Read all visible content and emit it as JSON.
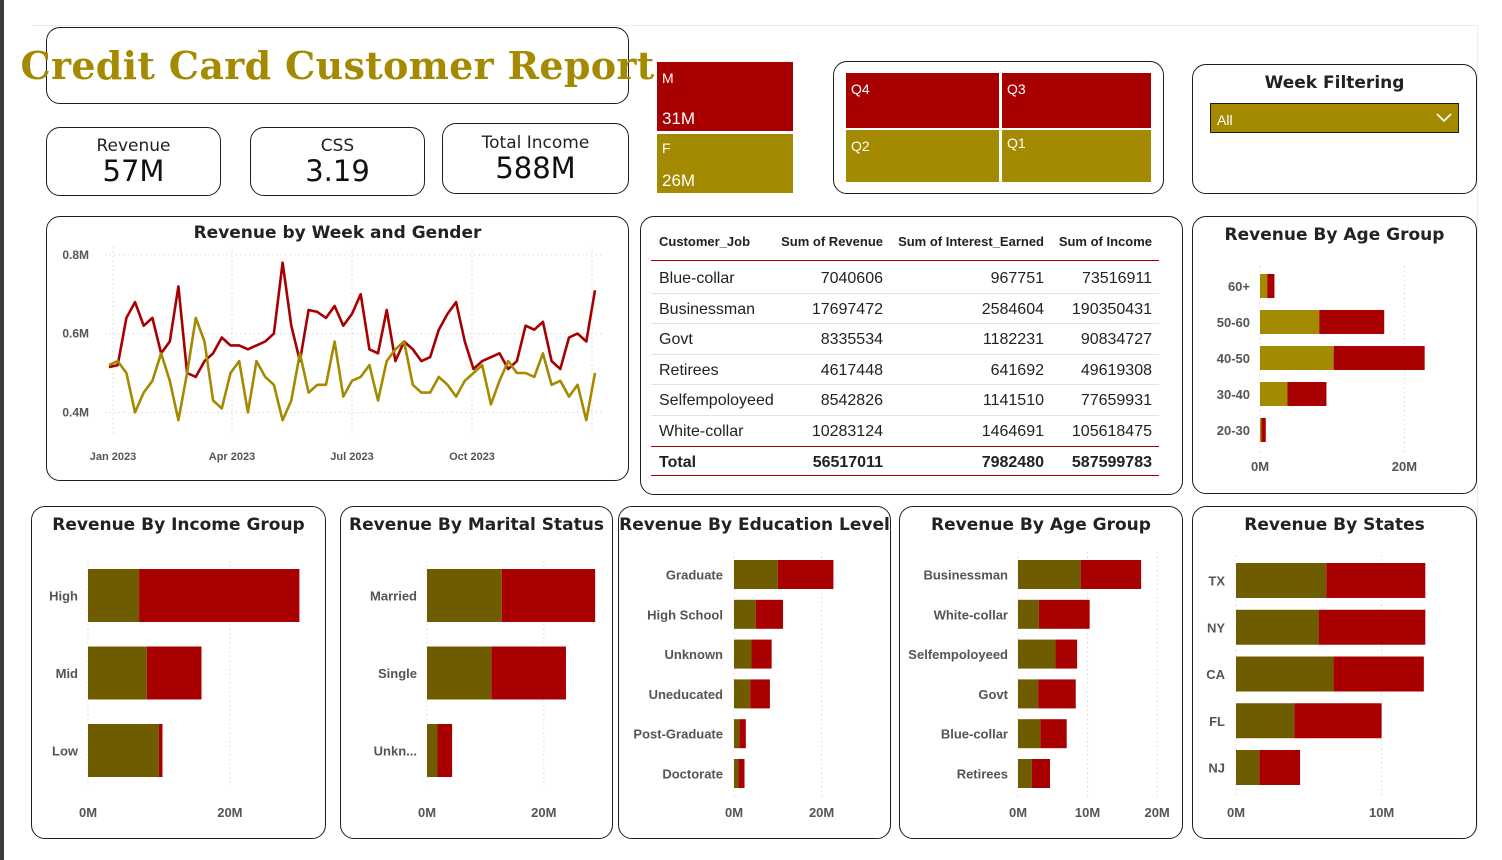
{
  "report": {
    "title": "Credit Card Customer Report"
  },
  "kpis": {
    "revenue": {
      "label": "Revenue",
      "value": "57M"
    },
    "css": {
      "label": "CSS",
      "value": "3.19"
    },
    "income": {
      "label": "Total Income",
      "value": "588M"
    }
  },
  "gender_tree": {
    "cells": [
      {
        "label": "M",
        "value": "31M"
      },
      {
        "label": "F",
        "value": "26M"
      }
    ]
  },
  "quarter_tree": {
    "cells": [
      "Q4",
      "Q3",
      "Q2",
      "Q1"
    ]
  },
  "filter": {
    "title": "Week Filtering",
    "selected": "All"
  },
  "colors": {
    "male": "#a80000",
    "female": "#a48a00",
    "female_dark": "#6f5c00",
    "grid": "#d9d9d9"
  },
  "table": {
    "headers": [
      "Customer_Job",
      "Sum of Revenue",
      "Sum of Interest_Earned",
      "Sum of Income"
    ],
    "rows": [
      [
        "Blue-collar",
        "7040606",
        "967751",
        "73516911"
      ],
      [
        "Businessman",
        "17697472",
        "2584604",
        "190350431"
      ],
      [
        "Govt",
        "8335534",
        "1182231",
        "90834727"
      ],
      [
        "Retirees",
        "4617448",
        "641692",
        "49619308"
      ],
      [
        "Selfempoloyeed",
        "8542826",
        "1141510",
        "77659931"
      ],
      [
        "White-collar",
        "10283124",
        "1464691",
        "105618475"
      ]
    ],
    "total": [
      "Total",
      "56517011",
      "7982480",
      "587599783"
    ]
  },
  "chart_data": [
    {
      "id": "week_gender",
      "type": "line",
      "title": "Revenue by Week and Gender",
      "x_ticks": [
        "Jan 2023",
        "Apr 2023",
        "Jul 2023",
        "Oct 2023"
      ],
      "y_ticks": [
        "0.4M",
        "0.6M",
        "0.8M"
      ],
      "ylim": [
        0.35,
        0.82
      ],
      "series": [
        {
          "color": "#a80000",
          "values": [
            0.515,
            0.52,
            0.64,
            0.68,
            0.62,
            0.64,
            0.55,
            0.58,
            0.72,
            0.5,
            0.49,
            0.53,
            0.55,
            0.59,
            0.57,
            0.57,
            0.56,
            0.57,
            0.58,
            0.6,
            0.78,
            0.62,
            0.53,
            0.66,
            0.655,
            0.64,
            0.67,
            0.62,
            0.65,
            0.7,
            0.56,
            0.55,
            0.66,
            0.53,
            0.58,
            0.56,
            0.53,
            0.54,
            0.61,
            0.65,
            0.68,
            0.58,
            0.51,
            0.53,
            0.54,
            0.55,
            0.51,
            0.53,
            0.62,
            0.61,
            0.63,
            0.53,
            0.51,
            0.59,
            0.6,
            0.58,
            0.71
          ]
        },
        {
          "color": "#a48a00",
          "values": [
            0.52,
            0.53,
            0.5,
            0.4,
            0.45,
            0.48,
            0.55,
            0.48,
            0.38,
            0.5,
            0.64,
            0.58,
            0.43,
            0.41,
            0.5,
            0.53,
            0.4,
            0.53,
            0.49,
            0.47,
            0.38,
            0.43,
            0.55,
            0.45,
            0.47,
            0.47,
            0.58,
            0.44,
            0.48,
            0.49,
            0.52,
            0.43,
            0.53,
            0.56,
            0.58,
            0.47,
            0.45,
            0.45,
            0.49,
            0.47,
            0.44,
            0.48,
            0.5,
            0.52,
            0.42,
            0.48,
            0.53,
            0.5,
            0.5,
            0.49,
            0.55,
            0.47,
            0.48,
            0.44,
            0.47,
            0.38,
            0.5
          ]
        }
      ]
    },
    {
      "id": "age_top",
      "type": "bar",
      "title": "Revenue By Age Group",
      "categories": [
        "60+",
        "50-60",
        "40-50",
        "30-40",
        "20-30"
      ],
      "series": [
        {
          "color": "#a48a00",
          "values": [
            1.0,
            8.2,
            10.2,
            3.8,
            0.2
          ]
        },
        {
          "color": "#a80000",
          "values": [
            1.0,
            9.0,
            12.6,
            5.4,
            0.6
          ]
        }
      ],
      "x_ticks": [
        {
          "v": 0,
          "label": "0M"
        },
        {
          "v": 20,
          "label": "20M"
        }
      ],
      "xlim": [
        0,
        27
      ]
    },
    {
      "id": "income_group",
      "type": "bar",
      "title": "Revenue By Income Group",
      "categories": [
        "High",
        "Mid",
        "Low"
      ],
      "series": [
        {
          "color": "#6f5c00",
          "values": [
            7.2,
            8.3,
            10.0
          ]
        },
        {
          "color": "#a80000",
          "values": [
            22.6,
            7.7,
            0.5
          ]
        }
      ],
      "x_ticks": [
        {
          "v": 0,
          "label": "0M"
        },
        {
          "v": 20,
          "label": "20M"
        }
      ],
      "xlim": [
        0,
        32
      ]
    },
    {
      "id": "marital",
      "type": "bar",
      "title": "Revenue By Marital Status",
      "categories": [
        "Married",
        "Single",
        "Unkn..."
      ],
      "series": [
        {
          "color": "#6f5c00",
          "values": [
            12.8,
            11.0,
            1.8
          ]
        },
        {
          "color": "#a80000",
          "values": [
            16.0,
            12.8,
            2.5
          ]
        }
      ],
      "x_ticks": [
        {
          "v": 0,
          "label": "0M"
        },
        {
          "v": 20,
          "label": "20M"
        }
      ],
      "xlim": [
        0,
        31
      ]
    },
    {
      "id": "education",
      "type": "bar",
      "title": "Revenue By Education Level",
      "categories": [
        "Graduate",
        "High School",
        "Unknown",
        "Uneducated",
        "Post-Graduate",
        "Doctorate"
      ],
      "series": [
        {
          "color": "#6f5c00",
          "values": [
            10.0,
            5.0,
            4.0,
            3.7,
            1.2,
            1.0
          ]
        },
        {
          "color": "#a80000",
          "values": [
            12.7,
            6.2,
            4.6,
            4.5,
            1.5,
            1.4
          ]
        }
      ],
      "x_ticks": [
        {
          "v": 0,
          "label": "0M"
        },
        {
          "v": 20,
          "label": "20M"
        }
      ],
      "xlim": [
        0,
        29
      ]
    },
    {
      "id": "job",
      "type": "bar",
      "title": "Revenue By Age Group",
      "categories": [
        "Businessman",
        "White-collar",
        "Selfempoloyeed",
        "Govt",
        "Blue-collar",
        "Retirees"
      ],
      "series": [
        {
          "color": "#6f5c00",
          "values": [
            9.0,
            3.0,
            5.4,
            2.9,
            3.2,
            2.0
          ]
        },
        {
          "color": "#a80000",
          "values": [
            8.7,
            7.3,
            3.1,
            5.4,
            3.8,
            2.6
          ]
        }
      ],
      "x_ticks": [
        {
          "v": 0,
          "label": "0M"
        },
        {
          "v": 10,
          "label": "10M"
        },
        {
          "v": 20,
          "label": "20M"
        }
      ],
      "xlim": [
        0,
        23
      ]
    },
    {
      "id": "states",
      "type": "bar",
      "title": "Revenue By States",
      "categories": [
        "TX",
        "NY",
        "CA",
        "FL",
        "NJ"
      ],
      "series": [
        {
          "color": "#6f5c00",
          "values": [
            6.2,
            5.7,
            6.7,
            4.0,
            1.6
          ]
        },
        {
          "color": "#a80000",
          "values": [
            6.8,
            7.3,
            6.2,
            6.0,
            2.8
          ]
        }
      ],
      "x_ticks": [
        {
          "v": 0,
          "label": "0M"
        },
        {
          "v": 10,
          "label": "10M"
        }
      ],
      "xlim": [
        0,
        16
      ]
    }
  ]
}
